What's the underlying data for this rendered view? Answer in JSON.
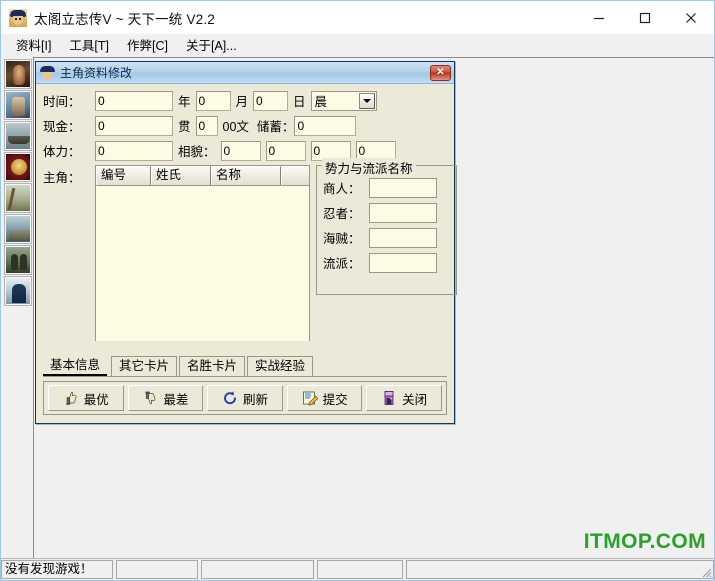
{
  "window": {
    "title": "太阁立志传V ~ 天下一统 V2.2",
    "icon": "app-icon",
    "controls": {
      "minimize": "minimize-icon",
      "maximize": "maximize-icon",
      "close": "close-icon"
    }
  },
  "menubar": {
    "items": [
      {
        "label": "资料[I]"
      },
      {
        "label": "工具[T]"
      },
      {
        "label": "作弊[C]"
      },
      {
        "label": "关于[A]..."
      }
    ]
  },
  "sidebar": {
    "items": [
      {
        "name": "thumb-portrait",
        "art": "art-portrait"
      },
      {
        "name": "thumb-archer",
        "art": "art-archer"
      },
      {
        "name": "thumb-ship",
        "art": "art-ship"
      },
      {
        "name": "thumb-crest",
        "art": "art-crest"
      },
      {
        "name": "thumb-battle",
        "art": "art-battle"
      },
      {
        "name": "thumb-castle",
        "art": "art-castle"
      },
      {
        "name": "thumb-figures",
        "art": "art-figures"
      },
      {
        "name": "thumb-samurai",
        "art": "art-samurai"
      }
    ]
  },
  "dialog": {
    "title": "主角资料修改",
    "close_label": "✕",
    "time": {
      "label": "时间：",
      "year_value": "0",
      "year_unit": "年",
      "month_value": "0",
      "month_unit": "月",
      "day_value": "0",
      "day_unit": "日",
      "period_value": "晨"
    },
    "cash": {
      "label": "现金：",
      "kan_value": "0",
      "kan_unit": "贯",
      "mon_value": "0",
      "mon_unit": "00文",
      "savings_label": "储蓄：",
      "savings_value": "0"
    },
    "stamina": {
      "label": "体力：",
      "value": "0",
      "looks_label": "相貌：",
      "looks_values": [
        "0",
        "0",
        "0",
        "0"
      ]
    },
    "hero": {
      "label": "主角：",
      "columns": [
        "编号",
        "姓氏",
        "名称",
        ""
      ],
      "rows": []
    },
    "factions": {
      "title": "势力与流派名称",
      "fields": [
        {
          "label": "商人：",
          "value": "",
          "focused": true
        },
        {
          "label": "忍者：",
          "value": "",
          "focused": false
        },
        {
          "label": "海贼：",
          "value": "",
          "focused": false
        },
        {
          "label": "流派：",
          "value": "",
          "focused": false
        }
      ]
    },
    "tabs": [
      {
        "label": "基本信息",
        "active": true
      },
      {
        "label": "其它卡片",
        "active": false
      },
      {
        "label": "名胜卡片",
        "active": false
      },
      {
        "label": "实战经验",
        "active": false
      }
    ],
    "buttons": [
      {
        "label": "最优",
        "icon": "thumbs-up-icon"
      },
      {
        "label": "最差",
        "icon": "thumbs-down-icon"
      },
      {
        "label": "刷新",
        "icon": "refresh-icon"
      },
      {
        "label": "提交",
        "icon": "submit-icon"
      },
      {
        "label": "关闭",
        "icon": "exit-door-icon"
      }
    ]
  },
  "watermark": {
    "text": "ITMOP.COM",
    "color": "#2aa12a"
  },
  "statusbar": {
    "panes": [
      "没有发现游戏！",
      "",
      "",
      "",
      ""
    ]
  }
}
